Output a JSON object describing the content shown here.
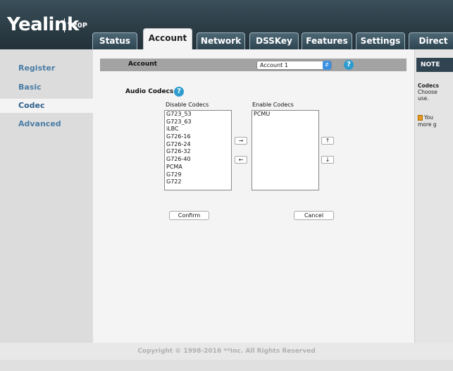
{
  "header": {
    "brand": "Yealink",
    "model": "T20P",
    "tabs": [
      {
        "label": "Status"
      },
      {
        "label": "Account"
      },
      {
        "label": "Network"
      },
      {
        "label": "DSSKey"
      },
      {
        "label": "Features"
      },
      {
        "label": "Settings"
      },
      {
        "label": "Direct"
      }
    ],
    "active_tab": "Account"
  },
  "sidebar": {
    "items": [
      {
        "label": "Register"
      },
      {
        "label": "Basic"
      },
      {
        "label": "Codec"
      },
      {
        "label": "Advanced"
      }
    ],
    "active_item": "Codec"
  },
  "account": {
    "label": "Account",
    "selected": "Account 1",
    "help_icon": "question-mark"
  },
  "codecs": {
    "section_label": "Audio Codecs",
    "disable_label": "Disable Codecs",
    "enable_label": "Enable Codecs",
    "disabled": [
      "G723_53",
      "G723_63",
      "iLBC",
      "G726-16",
      "G726-24",
      "G726-32",
      "G726-40",
      "PCMA",
      "G729",
      "G722"
    ],
    "enabled": [
      "PCMU"
    ],
    "move_right": "→",
    "move_left": "←",
    "move_up": "↑",
    "move_down": "↓",
    "confirm": "Confirm",
    "cancel": "Cancel"
  },
  "note": {
    "title": "NOTE",
    "heading": "Codecs",
    "line1": "Choose",
    "line2": "use.",
    "tip1": "You",
    "tip2": "more g"
  },
  "footer": {
    "copyright": "Copyright © 1998-2016 **Inc. All Rights Reserved"
  },
  "colors": {
    "header_bg": "#2b3b44",
    "link_blue": "#4a7da6",
    "help_blue": "#2e9ccf"
  }
}
